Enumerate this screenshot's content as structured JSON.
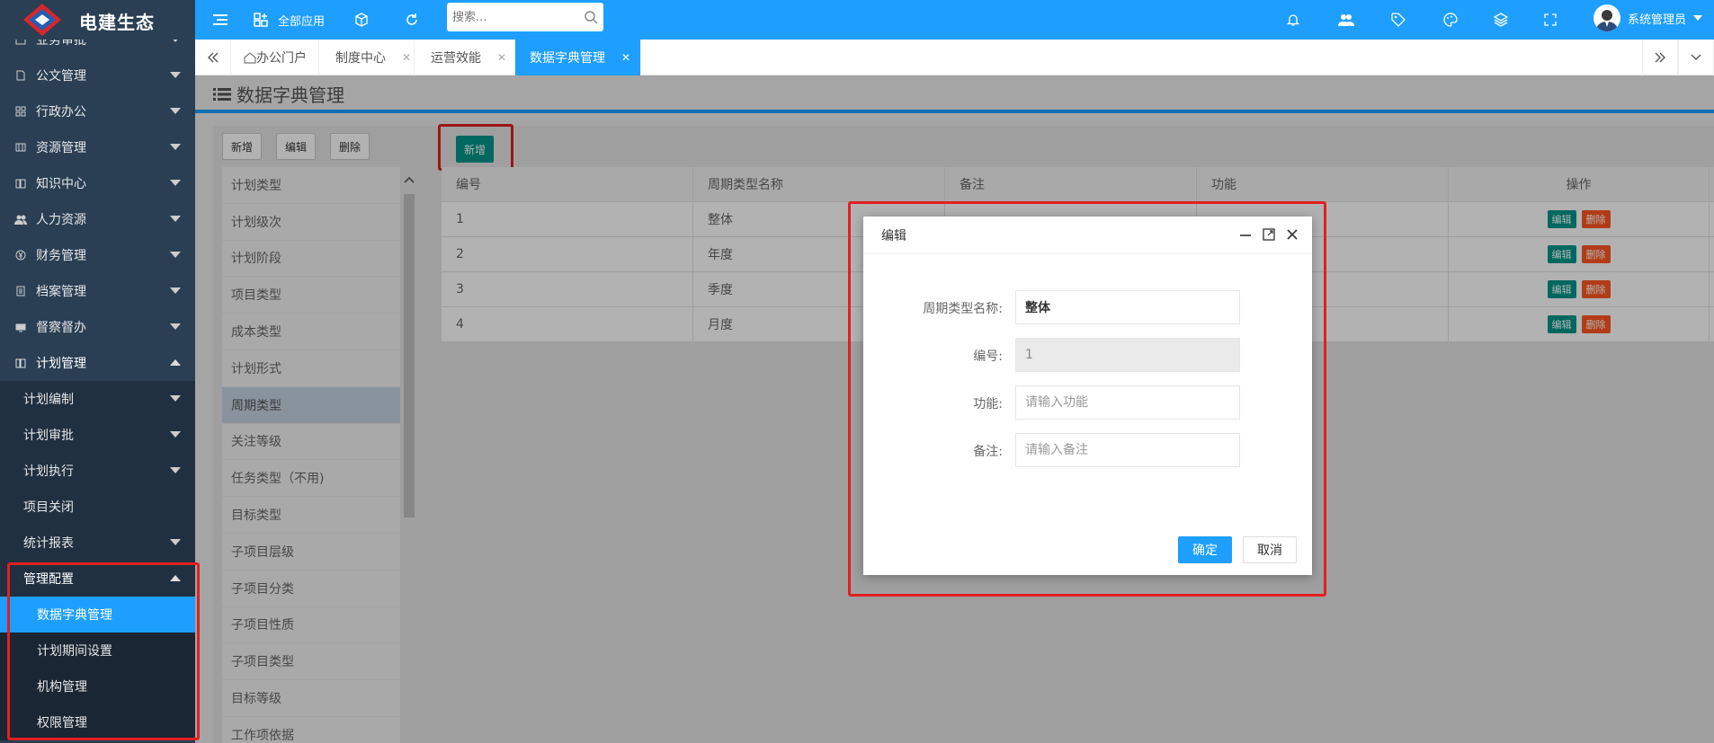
{
  "app": {
    "logo_text": "电建生态",
    "brand_color": "#1e9fff"
  },
  "header": {
    "all_apps": "全部应用",
    "search_placeholder": "搜索...",
    "user_name": "系统管理员"
  },
  "sidebar": {
    "items": [
      {
        "label": "业务审批",
        "icon": "document-icon"
      },
      {
        "label": "公文管理",
        "icon": "file-icon"
      },
      {
        "label": "行政办公",
        "icon": "grid-icon"
      },
      {
        "label": "资源管理",
        "icon": "table-icon"
      },
      {
        "label": "知识中心",
        "icon": "book-icon"
      },
      {
        "label": "人力资源",
        "icon": "users-icon"
      },
      {
        "label": "财务管理",
        "icon": "yen-icon"
      },
      {
        "label": "档案管理",
        "icon": "archive-icon"
      },
      {
        "label": "督察督办",
        "icon": "monitor-icon"
      },
      {
        "label": "计划管理",
        "icon": "plan-icon"
      }
    ],
    "plan_sub": [
      "计划编制",
      "计划审批",
      "计划执行",
      "项目关闭",
      "统计报表",
      "管理配置"
    ],
    "config_sub": [
      "数据字典管理",
      "计划期间设置",
      "机构管理",
      "权限管理"
    ]
  },
  "tabs": [
    {
      "label": "办公门户"
    },
    {
      "label": "制度中心"
    },
    {
      "label": "运营效能"
    },
    {
      "label": "数据字典管理"
    }
  ],
  "page": {
    "title": "数据字典管理",
    "left_buttons": [
      "新增",
      "编辑",
      "删除"
    ],
    "add_button": "新增"
  },
  "dict_list": [
    "计划类型",
    "计划级次",
    "计划阶段",
    "项目类型",
    "成本类型",
    "计划形式",
    "周期类型",
    "关注等级",
    "任务类型（不用)",
    "目标类型",
    "子项目层级",
    "子项目分类",
    "子项目性质",
    "子项目类型",
    "目标等级",
    "工作项依据"
  ],
  "table": {
    "headers": [
      "编号",
      "周期类型名称",
      "备注",
      "功能",
      "操作"
    ],
    "rows": [
      [
        "1",
        "整体"
      ],
      [
        "2",
        "年度"
      ],
      [
        "3",
        "季度"
      ],
      [
        "4",
        "月度"
      ]
    ],
    "edit_label": "编辑",
    "delete_label": "删除"
  },
  "modal": {
    "title": "编辑",
    "fields": {
      "name_label": "周期类型名称:",
      "name_value": "整体",
      "code_label": "编号:",
      "code_value": "1",
      "func_label": "功能:",
      "func_placeholder": "请输入功能",
      "note_label": "备注:",
      "note_placeholder": "请输入备注"
    },
    "ok": "确定",
    "cancel": "取消"
  }
}
